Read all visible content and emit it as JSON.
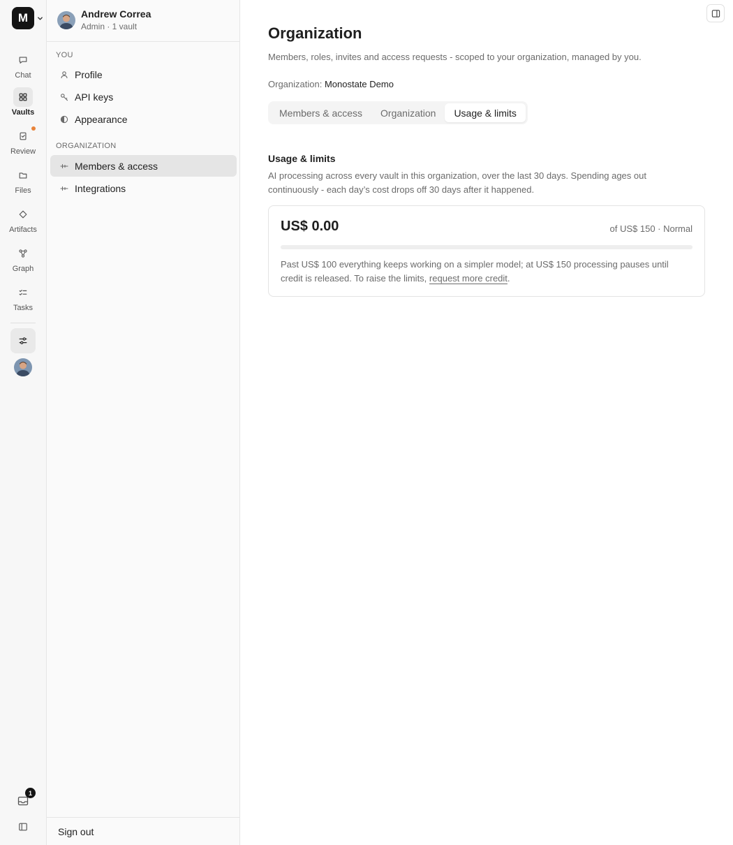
{
  "workspace": {
    "initial": "M"
  },
  "rail": {
    "items": [
      {
        "label": "Chat",
        "icon": "chat-icon"
      },
      {
        "label": "Vaults",
        "icon": "vaults-icon",
        "active": true
      },
      {
        "label": "Review",
        "icon": "review-icon",
        "has_dot": true
      },
      {
        "label": "Files",
        "icon": "folder-icon"
      },
      {
        "label": "Artifacts",
        "icon": "diamond-icon"
      },
      {
        "label": "Graph",
        "icon": "graph-icon"
      },
      {
        "label": "Tasks",
        "icon": "tasks-icon"
      }
    ],
    "inbox_badge": "1",
    "notification_dot_color": "#e8833a"
  },
  "user": {
    "name": "Andrew Correa",
    "meta": "Admin · 1 vault"
  },
  "sidebar": {
    "you_label": "YOU",
    "you_items": [
      {
        "label": "Profile",
        "icon": "person-icon"
      },
      {
        "label": "API keys",
        "icon": "key-icon"
      },
      {
        "label": "Appearance",
        "icon": "contrast-icon"
      }
    ],
    "org_label": "ORGANIZATION",
    "org_items": [
      {
        "label": "Members & access",
        "icon": "members-icon",
        "active": true
      },
      {
        "label": "Integrations",
        "icon": "integrations-icon"
      }
    ],
    "signout_label": "Sign out"
  },
  "main": {
    "title": "Organization",
    "subtitle": "Members, roles, invites and access requests - scoped to your organization, managed by you.",
    "org_prefix": "Organization:",
    "org_name": "Monostate Demo",
    "tabs": [
      {
        "label": "Members & access"
      },
      {
        "label": "Organization"
      },
      {
        "label": "Usage & limits",
        "active": true
      }
    ],
    "usage": {
      "section_title": "Usage & limits",
      "section_desc": "AI processing across every vault in this organization, over the last 30 days. Spending ages out continuously - each day’s cost drops off 30 days after it happened.",
      "amount": "US$ 0.00",
      "limit": "of US$ 150 · Normal",
      "progress_fraction": 0,
      "note_prefix": "Past US$ 100 everything keeps working on a simpler model; at US$ 150 processing pauses until credit is released. To raise the limits,",
      "note_link": "request more credit",
      "note_suffix": "."
    }
  }
}
